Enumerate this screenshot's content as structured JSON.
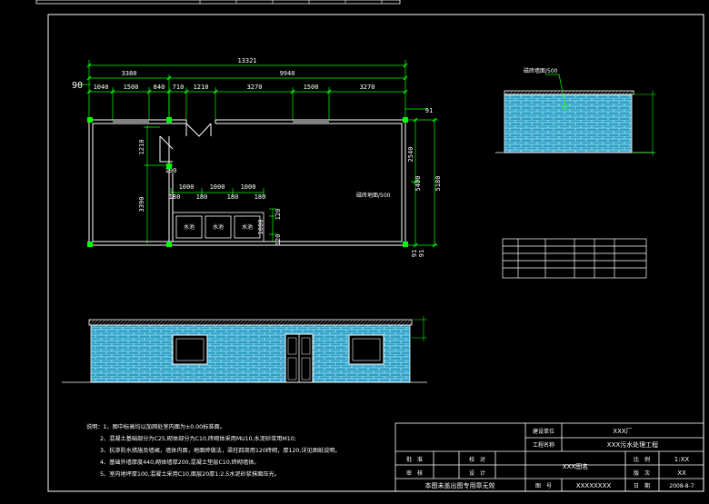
{
  "plan": {
    "overall": "13321",
    "seg_left": "3380",
    "seg_right": "9940",
    "detail": [
      "1040",
      "1500",
      "840",
      "710",
      "1210",
      "3270",
      "1500",
      "3270"
    ],
    "left_edge": "90",
    "right_dims": [
      "2540",
      "5400",
      "5180"
    ],
    "left_dims": [
      "1210",
      "3390"
    ],
    "cabinet_dims": [
      "1000",
      "1000",
      "1000"
    ],
    "cabinet_small": [
      "180",
      "180",
      "180",
      "180"
    ],
    "cabinet_right": [
      "120",
      "1000",
      "120"
    ],
    "door_gap": "190",
    "room_label": "磁砖地面/500",
    "cabinets": [
      "水池",
      "水池",
      "水池"
    ],
    "top_tag": "91",
    "bottom_tags": [
      "91",
      "91"
    ]
  },
  "side_view": {
    "label": "磁砖墙面/500"
  },
  "notes": [
    "说明：1、图中标高均以加固处室内面为±0.00标准面。",
    "2、混凝土基础部分为C25,砌体部分为C10,砖砌体采用MU10,水泥砂浆用M10;",
    "3、抗渗防水措施及墙裙，墙体内面，地面砖做法，梁柱四周用120砖砌，厚120,详见图纸说明。",
    "4、基础外墙厚度440,砌体墙厚200,混凝土垫层C10,砖砌墙体。",
    "5、室内地坪厚100,混凝土采用C10,面层20厚1:2.5水泥砂浆抹面压光。"
  ],
  "title_block": {
    "design_unit_label": "建设单位",
    "design_unit": "XXX厂",
    "project_label": "工程名称",
    "project": "XXX污水处理工程",
    "drawing_name": "XXX图名",
    "approve": "批　准",
    "check": "校　对",
    "review": "审　核",
    "design": "设　计",
    "scale_label": "比　例",
    "scale": "1:XX",
    "sheet_label": "版　次",
    "sheet": "XX",
    "drawing_no_label": "图　号",
    "drawing_no": "XXXXXXXX",
    "date_label": "日　期",
    "date": "2008-8-7",
    "stamp_note": "本图未盖出图专用章无效"
  },
  "colors": {
    "bg": "#000000",
    "line": "#ffffff",
    "dim": "#00ff00",
    "brick": "#2f9fc6",
    "brick_mortar": "#a8e7f5"
  }
}
